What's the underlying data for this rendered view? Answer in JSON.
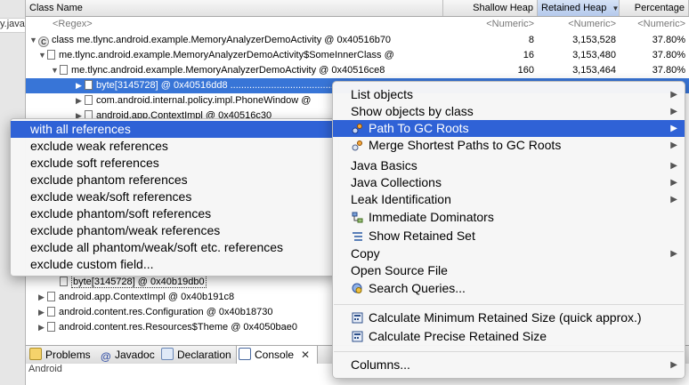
{
  "editor_tab_fragment": "y.java",
  "table": {
    "columns": {
      "class_name": "Class Name",
      "shallow_heap": "Shallow Heap",
      "retained_heap": "Retained Heap",
      "percentage": "Percentage",
      "sort_indicator": "▼"
    },
    "filter_row": {
      "class_name": "<Regex>",
      "shallow_heap": "<Numeric>",
      "retained_heap": "<Numeric>",
      "percentage": "<Numeric>"
    },
    "rows": [
      {
        "name": "class me.tlync.android.example.MemoryAnalyzerDemoActivity @ 0x40516b70",
        "shallow": "8",
        "retained": "3,153,528",
        "pct": "37.80%"
      },
      {
        "name": "me.tlync.android.example.MemoryAnalyzerDemoActivity$SomeInnerClass @",
        "shallow": "16",
        "retained": "3,153,480",
        "pct": "37.80%"
      },
      {
        "name": "me.tlync.android.example.MemoryAnalyzerDemoActivity @ 0x40516ce8",
        "shallow": "160",
        "retained": "3,153,464",
        "pct": "37.80%"
      },
      {
        "name": "byte[3145728] @ 0x40516dd8 ........................................"
      },
      {
        "name": "com.android.internal.policy.impl.PhoneWindow @"
      },
      {
        "name": "android.app.ContextImpl @ 0x40516c30"
      },
      {
        "name": "byte[3145728] @ 0x40b19db0"
      },
      {
        "name": "android.app.ContextImpl @ 0x40b191c8"
      },
      {
        "name": "android.content.res.Configuration @ 0x40b18730"
      },
      {
        "name": "android.content.res.Resources$Theme @ 0x4050bae0"
      }
    ]
  },
  "context_menu": {
    "items": [
      {
        "label": "List objects",
        "submenu": true
      },
      {
        "label": "Show objects by class",
        "submenu": true
      },
      {
        "label": "Path To GC Roots",
        "submenu": true,
        "icon": "path-to-gc-roots-icon",
        "highlighted": true
      },
      {
        "label": "Merge Shortest Paths to GC Roots",
        "submenu": true,
        "icon": "merge-paths-icon"
      },
      {
        "label": "Java Basics",
        "submenu": true
      },
      {
        "label": "Java Collections",
        "submenu": true
      },
      {
        "label": "Leak Identification",
        "submenu": true
      },
      {
        "label": "Immediate Dominators",
        "icon": "dominators-icon"
      },
      {
        "label": "Show Retained Set",
        "icon": "retained-set-icon"
      },
      {
        "label": "Copy",
        "submenu": true
      },
      {
        "label": "Open Source File"
      },
      {
        "label": "Search Queries...",
        "icon": "search-queries-icon"
      },
      {
        "separator": true
      },
      {
        "label": "Calculate Minimum Retained Size (quick approx.)",
        "icon": "calculator-icon"
      },
      {
        "label": "Calculate Precise Retained Size",
        "icon": "calculator-icon"
      },
      {
        "separator": true
      },
      {
        "label": "Columns...",
        "submenu": true
      }
    ]
  },
  "submenu": {
    "items": [
      {
        "label": "with all references",
        "highlighted": true
      },
      {
        "label": "exclude weak references"
      },
      {
        "label": "exclude soft references"
      },
      {
        "label": "exclude phantom references"
      },
      {
        "label": "exclude weak/soft references"
      },
      {
        "label": "exclude phantom/soft references"
      },
      {
        "label": "exclude phantom/weak references"
      },
      {
        "label": "exclude all phantom/weak/soft etc. references"
      },
      {
        "label": "exclude custom field..."
      }
    ]
  },
  "bottom_tabs": [
    {
      "label": "Problems",
      "icon": "problems-icon"
    },
    {
      "label": "Javadoc",
      "icon": "javadoc-icon"
    },
    {
      "label": "Declaration",
      "icon": "declaration-icon"
    },
    {
      "label": "Console",
      "icon": "console-icon",
      "active": true,
      "close": "✕"
    }
  ],
  "console_text": "Android",
  "colors": {
    "selection": "#3875d7",
    "menu_highlight": "#2f62d6"
  }
}
